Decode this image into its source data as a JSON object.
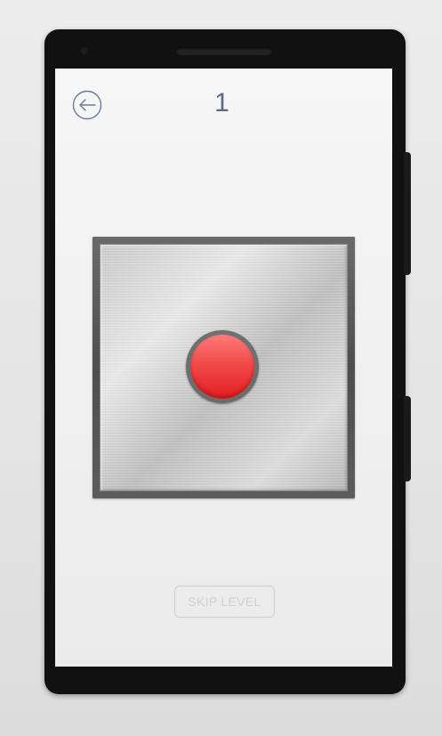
{
  "header": {
    "back_icon": "circle-arrow-left-icon",
    "level": "1"
  },
  "game": {
    "board": "brushed-metal-plate",
    "button_color": "#e5262a"
  },
  "footer": {
    "skip_label": "SKIP LEVEL"
  },
  "colors": {
    "accent": "#5a6a85",
    "skip_border": "#cfcfcf"
  }
}
